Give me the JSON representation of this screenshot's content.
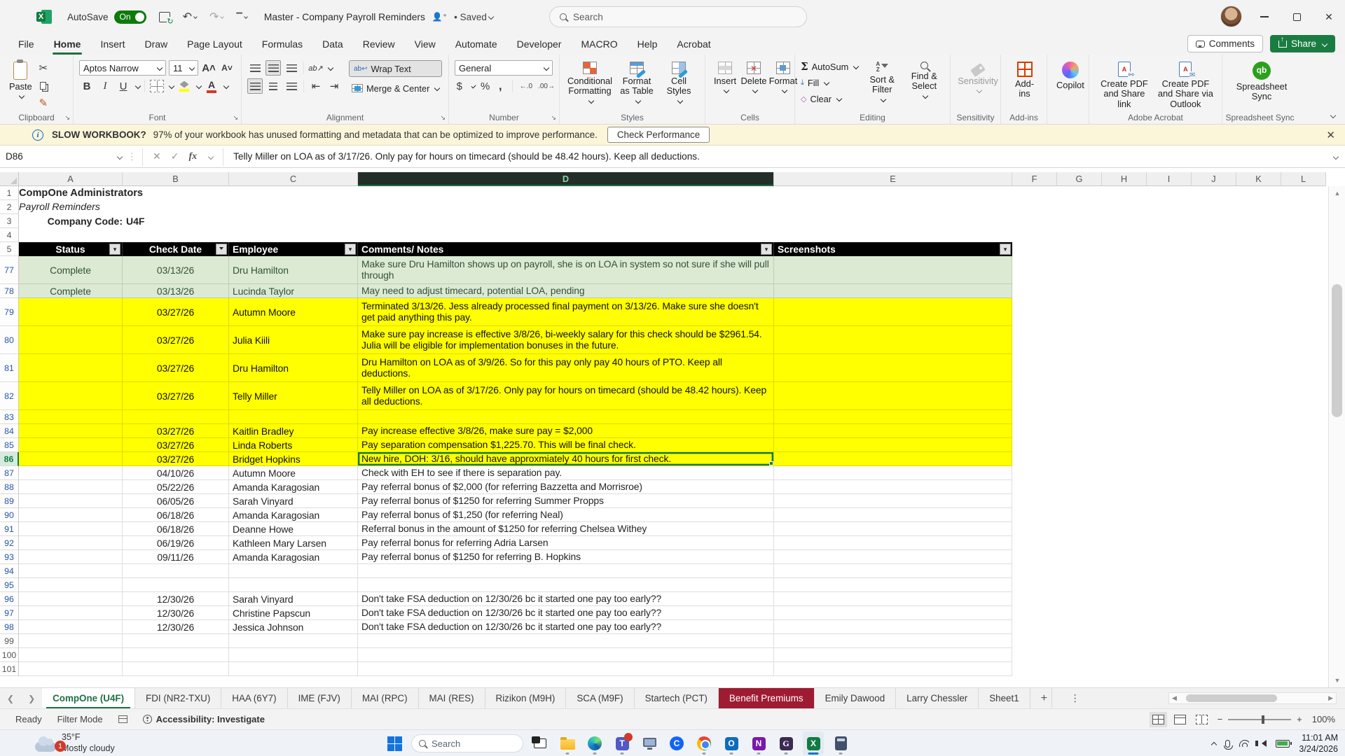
{
  "titlebar": {
    "autosave_label": "AutoSave",
    "autosave_state": "On",
    "title": "Master - Company Payroll Reminders",
    "saved_label": "Saved",
    "search_placeholder": "Search"
  },
  "menu": {
    "tabs": [
      "File",
      "Home",
      "Insert",
      "Draw",
      "Page Layout",
      "Formulas",
      "Data",
      "Review",
      "View",
      "Automate",
      "Developer",
      "MACRO",
      "Help",
      "Acrobat"
    ],
    "active_tab": "Home",
    "comments_label": "Comments",
    "share_label": "Share"
  },
  "ribbon": {
    "clipboard": {
      "paste": "Paste",
      "label": "Clipboard"
    },
    "font": {
      "name": "Aptos Narrow",
      "size": "11",
      "bold": "B",
      "italic": "I",
      "underline": "U",
      "label": "Font"
    },
    "alignment": {
      "wrap": "Wrap Text",
      "merge": "Merge & Center",
      "orient": "ab",
      "label": "Alignment"
    },
    "number": {
      "format": "General",
      "currency": "$",
      "percent": "%",
      "comma": ",",
      "dec_inc": "←.0",
      "dec_dec": ".00→",
      "label": "Number"
    },
    "styles": {
      "conditional": "Conditional Formatting",
      "format_table": "Format as Table",
      "cell_styles": "Cell Styles",
      "label": "Styles"
    },
    "cells": {
      "insert": "Insert",
      "delete": "Delete",
      "format": "Format",
      "label": "Cells"
    },
    "editing": {
      "autosum": "AutoSum",
      "fill": "Fill",
      "clear": "Clear",
      "sort": "Sort & Filter",
      "find": "Find & Select",
      "label": "Editing"
    },
    "sensitivity": {
      "button": "Sensitivity",
      "label": "Sensitivity"
    },
    "addins": {
      "button": "Add-ins",
      "label": "Add-ins"
    },
    "copilot": {
      "button": "Copilot"
    },
    "acrobat": {
      "pdf_link": "Create PDF and Share link",
      "pdf_outlook": "Create PDF and Share via Outlook",
      "label": "Adobe Acrobat"
    },
    "sync": {
      "button": "Spreadsheet Sync",
      "label": "Spreadsheet Sync",
      "qb": "qb"
    }
  },
  "warning": {
    "title": "SLOW WORKBOOK?",
    "message": "97% of your workbook has unused formatting and metadata that can be optimized to improve performance.",
    "action": "Check Performance"
  },
  "formula_bar": {
    "cell_ref": "D86",
    "fx": "fx",
    "value": "Telly Miller on LOA as of 3/17/26. Only pay for hours on timecard (should be 48.42 hours). Keep all deductions."
  },
  "sheet": {
    "col_letters": [
      "A",
      "B",
      "C",
      "D",
      "E",
      "F",
      "G",
      "H",
      "I",
      "J",
      "K",
      "L"
    ],
    "selected_col": "D",
    "title": "CompOne Administrators",
    "subtitle": "Payroll Reminders",
    "code_label": "Company Code:",
    "code_value": "U4F",
    "headers": [
      "Status",
      "Check Date",
      "Employee",
      "Comments/ Notes",
      "Screenshots"
    ],
    "rows": [
      {
        "n": 77,
        "h": 2,
        "f": "g",
        "s": "Complete",
        "d": "03/13/26",
        "e": "Dru Hamilton",
        "c": "Make sure Dru Hamilton shows up on payroll, she is on LOA in system so not sure if she will pull through"
      },
      {
        "n": 78,
        "h": 1,
        "f": "g",
        "s": "Complete",
        "d": "03/13/26",
        "e": "Lucinda Taylor",
        "c": "May need to adjust timecard, potential LOA, pending"
      },
      {
        "n": 79,
        "h": 2,
        "f": "y",
        "s": "",
        "d": "03/27/26",
        "e": "Autumn Moore",
        "c": "Terminated 3/13/26. Jess already processed final payment on 3/13/26. Make sure she doesn't get paid anything this pay."
      },
      {
        "n": 80,
        "h": 2,
        "f": "y",
        "s": "",
        "d": "03/27/26",
        "e": "Julia Kiili",
        "c": "Make sure pay increase is effective 3/8/26, bi-weekly salary for this check should be $2961.54. Julia will be eligible for implementation bonuses in the future."
      },
      {
        "n": 81,
        "h": 2,
        "f": "y",
        "s": "",
        "d": "03/27/26",
        "e": "Dru Hamilton",
        "c": "Dru Hamilton on LOA as of 3/9/26. So for this pay only pay 40 hours of PTO. Keep all deductions."
      },
      {
        "n": 82,
        "h": 2,
        "f": "y",
        "s": "",
        "d": "03/27/26",
        "e": "Telly Miller",
        "c": "Telly Miller on LOA as of 3/17/26. Only pay for hours on timecard (should be 48.42 hours). Keep all deductions."
      },
      {
        "n": 83,
        "h": 1,
        "f": "y",
        "s": "",
        "d": "",
        "e": "",
        "c": ""
      },
      {
        "n": 84,
        "h": 1,
        "f": "y",
        "s": "",
        "d": "03/27/26",
        "e": "Kaitlin Bradley",
        "c": "Pay increase effective 3/8/26, make sure pay = $2,000"
      },
      {
        "n": 85,
        "h": 1,
        "f": "y",
        "s": "",
        "d": "03/27/26",
        "e": "Linda Roberts",
        "c": "Pay separation compensation $1,225.70. This will be final check."
      },
      {
        "n": 86,
        "h": 1,
        "f": "y",
        "sel": true,
        "s": "",
        "d": "03/27/26",
        "e": "Bridget Hopkins",
        "c": "New hire, DOH: 3/16, should have approxmiately 40 hours for first check."
      },
      {
        "n": 87,
        "h": 1,
        "f": "w",
        "s": "",
        "d": "04/10/26",
        "e": "Autumn Moore",
        "c": "Check with EH to see if there is separation pay."
      },
      {
        "n": 88,
        "h": 1,
        "f": "w",
        "s": "",
        "d": "05/22/26",
        "e": "Amanda Karagosian",
        "c": "Pay referral bonus of $2,000 (for referring Bazzetta and Morrisroe)"
      },
      {
        "n": 89,
        "h": 1,
        "f": "w",
        "s": "",
        "d": "06/05/26",
        "e": "Sarah Vinyard",
        "c": "Pay referral bonus of $1250 for referring Summer Propps"
      },
      {
        "n": 90,
        "h": 1,
        "f": "w",
        "s": "",
        "d": "06/18/26",
        "e": "Amanda Karagosian",
        "c": "Pay referral bonus of $1,250 (for referring Neal)"
      },
      {
        "n": 91,
        "h": 1,
        "f": "w",
        "s": "",
        "d": "06/18/26",
        "e": "Deanne Howe",
        "c": "Referral bonus in the amount of $1250 for referring Chelsea Withey"
      },
      {
        "n": 92,
        "h": 1,
        "f": "w",
        "s": "",
        "d": "06/19/26",
        "e": "Kathleen Mary Larsen",
        "c": "Pay referral bonus for referring Adria Larsen"
      },
      {
        "n": 93,
        "h": 1,
        "f": "w",
        "s": "",
        "d": "09/11/26",
        "e": "Amanda Karagosian",
        "c": "Pay referral bonus of $1250 for referring B. Hopkins"
      },
      {
        "n": 94,
        "h": 1,
        "f": "w",
        "s": "",
        "d": "",
        "e": "",
        "c": ""
      },
      {
        "n": 95,
        "h": 1,
        "f": "w",
        "s": "",
        "d": "",
        "e": "",
        "c": ""
      },
      {
        "n": 96,
        "h": 1,
        "f": "w",
        "s": "",
        "d": "12/30/26",
        "e": "Sarah Vinyard",
        "c": "Don't take FSA deduction on 12/30/26 bc it started one pay too early??"
      },
      {
        "n": 97,
        "h": 1,
        "f": "w",
        "s": "",
        "d": "12/30/26",
        "e": "Christine Papscun",
        "c": "Don't take FSA deduction on 12/30/26 bc it started one pay too early??"
      },
      {
        "n": 98,
        "h": 1,
        "f": "w",
        "s": "",
        "d": "12/30/26",
        "e": "Jessica Johnson",
        "c": "Don't take FSA deduction on 12/30/26 bc it started one pay too early??"
      },
      {
        "n": 99,
        "h": 1,
        "f": "w",
        "s": "",
        "d": "",
        "e": "",
        "c": ""
      },
      {
        "n": 100,
        "h": 1,
        "f": "w",
        "s": "",
        "d": "",
        "e": "",
        "c": ""
      },
      {
        "n": 101,
        "h": 1,
        "f": "w",
        "s": "",
        "d": "",
        "e": "",
        "c": ""
      }
    ]
  },
  "tabs": {
    "sheets": [
      {
        "label": "CompOne (U4F)",
        "active": true
      },
      {
        "label": "FDI (NR2-TXU)"
      },
      {
        "label": "HAA (6Y7)"
      },
      {
        "label": "IME (FJV)"
      },
      {
        "label": "MAI (RPC)"
      },
      {
        "label": "MAI (RES)"
      },
      {
        "label": "Rizikon (M9H)"
      },
      {
        "label": "SCA (M9F)"
      },
      {
        "label": "Startech (PCT)"
      },
      {
        "label": "Benefit Premiums",
        "dark": true
      },
      {
        "label": "Emily Dawood"
      },
      {
        "label": "Larry Chessler"
      },
      {
        "label": "Sheet1"
      }
    ],
    "add_label": "+"
  },
  "statusbar": {
    "ready": "Ready",
    "filter_mode": "Filter Mode",
    "accessibility": "Accessibility: Investigate",
    "zoom": "100%"
  },
  "taskbar": {
    "weather_temp": "35°F",
    "weather_desc": "Mostly cloudy",
    "weather_badge": "1",
    "search_placeholder": "Search",
    "teams_letter": "T",
    "time": "11:01 AM",
    "date": "3/24/2026"
  },
  "colors": {
    "excel_green": "#1E7145",
    "selection_green": "#107C41",
    "row_yellow": "#FFFF00",
    "row_green": "#DCEAD4",
    "header_black": "#000000",
    "benefit_tab_red": "#9E1B32",
    "addins_orange": "#D83B01",
    "qb_green": "#2CA01C",
    "warning_yellow": "#FBF5DA"
  }
}
